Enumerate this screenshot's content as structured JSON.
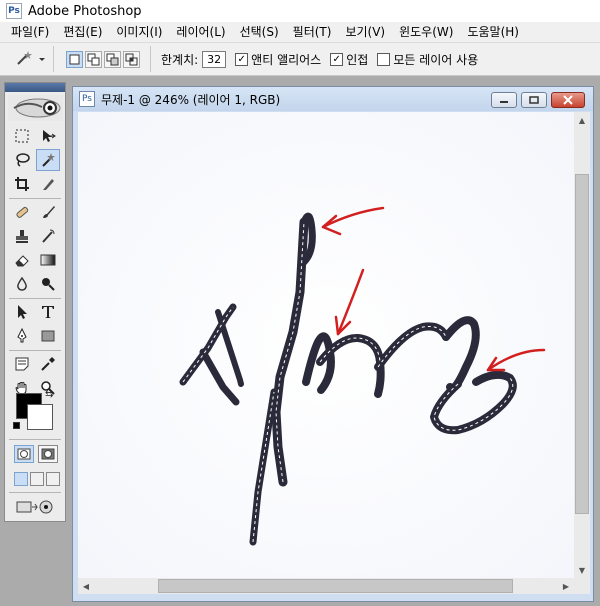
{
  "app": {
    "title": "Adobe Photoshop",
    "icon": "photoshop-app-icon",
    "icon_glyph": "Ps"
  },
  "menu": {
    "items": [
      {
        "label": "파일(F)"
      },
      {
        "label": "편집(E)"
      },
      {
        "label": "이미지(I)"
      },
      {
        "label": "레이어(L)"
      },
      {
        "label": "선택(S)"
      },
      {
        "label": "필터(T)"
      },
      {
        "label": "보기(V)"
      },
      {
        "label": "윈도우(W)"
      },
      {
        "label": "도움말(H)"
      }
    ]
  },
  "options": {
    "tolerance_label": "한계치:",
    "tolerance_value": "32",
    "antialias": {
      "label": "앤티 앨리어스",
      "checked": true,
      "mark": "✓"
    },
    "contiguous": {
      "label": "인접",
      "checked": true,
      "mark": "✓"
    },
    "sample_all_layers": {
      "label": "모든 레이어 사용",
      "checked": false,
      "mark": ""
    }
  },
  "toolbox": {
    "selected_tool": "magic-wand",
    "foreground_color": "#000000",
    "background_color": "#ffffff",
    "swap_glyph": "⇆"
  },
  "document": {
    "title": "무제-1 @ 246% (레이어 1, RGB)",
    "icon_glyph": "Ps",
    "annotation_color": "#d21f1f",
    "ink_color": "#2a2a3a"
  },
  "colors": {
    "accent": "#c9def5",
    "window_frame": "#cfdff1",
    "close_button": "#c8432f"
  }
}
